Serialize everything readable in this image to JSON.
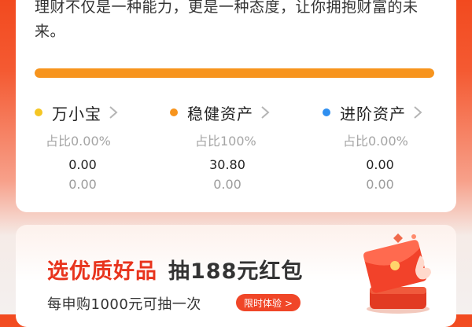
{
  "intro": {
    "text": "理财不仅是一种能力，更是一种态度，让你拥抱财富的未来。"
  },
  "allocation_bar": {
    "fill_fraction": 1.0,
    "color": "#f7941d",
    "track_color": "#ececec"
  },
  "assets": [
    {
      "label": "万小宝",
      "ratio": "占比0.00%",
      "amount": "0.00",
      "secondary": "0.00",
      "dot_color": "#f5c623",
      "icon": "chevron-right-icon"
    },
    {
      "label": "稳健资产",
      "ratio": "占比100%",
      "amount": "30.80",
      "secondary": "0.00",
      "dot_color": "#f7941d",
      "icon": "chevron-right-icon"
    },
    {
      "label": "进阶资产",
      "ratio": "占比0.00%",
      "amount": "0.00",
      "secondary": "0.00",
      "dot_color": "#2f8ff0",
      "icon": "chevron-right-icon"
    }
  ],
  "promo": {
    "title_highlight": "选优质好品",
    "title_rest": "抽188元红包",
    "subtitle": "每申购1000元可抽一次",
    "badge": "限时体验 >",
    "icon": "red-envelope-icon",
    "accent": "#e8341d"
  }
}
